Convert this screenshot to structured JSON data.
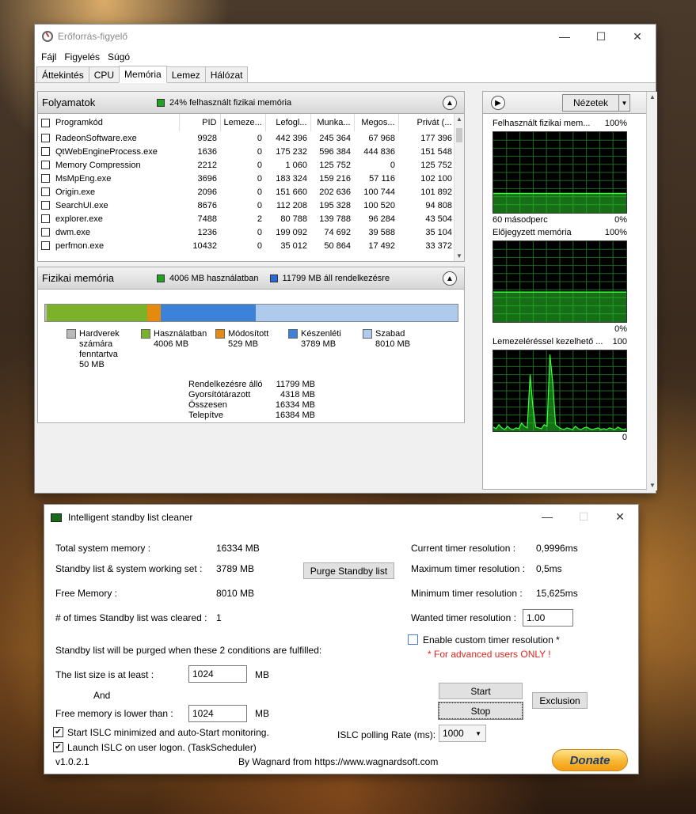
{
  "resmon": {
    "title": "Erőforrás-figyelő",
    "menu": [
      "Fájl",
      "Figyelés",
      "Súgó"
    ],
    "tabs": [
      "Áttekintés",
      "CPU",
      "Memória",
      "Lemez",
      "Hálózat"
    ],
    "active_tab": "Memória",
    "processes": {
      "title": "Folyamatok",
      "info": "24% felhasznált fizikai memória",
      "columns": [
        "Programkód",
        "PID",
        "Lemeze...",
        "Lefogl...",
        "Munka...",
        "Megos...",
        "Privát (..."
      ],
      "rows": [
        [
          "RadeonSoftware.exe",
          "9928",
          "0",
          "442 396",
          "245 364",
          "67 968",
          "177 396"
        ],
        [
          "QtWebEngineProcess.exe",
          "1636",
          "0",
          "175 232",
          "596 384",
          "444 836",
          "151 548"
        ],
        [
          "Memory Compression",
          "2212",
          "0",
          "1 060",
          "125 752",
          "0",
          "125 752"
        ],
        [
          "MsMpEng.exe",
          "3696",
          "0",
          "183 324",
          "159 216",
          "57 116",
          "102 100"
        ],
        [
          "Origin.exe",
          "2096",
          "0",
          "151 660",
          "202 636",
          "100 744",
          "101 892"
        ],
        [
          "SearchUI.exe",
          "8676",
          "0",
          "112 208",
          "195 328",
          "100 520",
          "94 808"
        ],
        [
          "explorer.exe",
          "7488",
          "2",
          "80 788",
          "139 788",
          "96 284",
          "43 504"
        ],
        [
          "dwm.exe",
          "1236",
          "0",
          "199 092",
          "74 692",
          "39 588",
          "35 104"
        ],
        [
          "perfmon.exe",
          "10432",
          "0",
          "35 012",
          "50 864",
          "17 492",
          "33 372"
        ]
      ]
    },
    "physical": {
      "title": "Fizikai memória",
      "info_used": "4006 MB használatban",
      "info_avail": "11799 MB áll rendelkezésre",
      "bar": [
        {
          "name": "hardware",
          "value": 50,
          "color": "#b9b9b9"
        },
        {
          "name": "in-use",
          "value": 4006,
          "color": "#7bb22a"
        },
        {
          "name": "modified",
          "value": 529,
          "color": "#e48a0e"
        },
        {
          "name": "standby",
          "value": 3789,
          "color": "#3c82d8"
        },
        {
          "name": "free",
          "value": 8010,
          "color": "#aecbee"
        }
      ],
      "legend": [
        {
          "label": "Hardverek",
          "sub": "számára",
          "sub2": "fenntartva",
          "value": "50 MB",
          "color": "#b9b9b9"
        },
        {
          "label": "Használatban",
          "value": "4006 MB",
          "color": "#7bb22a"
        },
        {
          "label": "Módosított",
          "value": "529 MB",
          "color": "#e48a0e"
        },
        {
          "label": "Készenléti",
          "value": "3789 MB",
          "color": "#3c82d8"
        },
        {
          "label": "Szabad",
          "value": "8010 MB",
          "color": "#aecbee"
        }
      ],
      "stats": [
        {
          "k": "Rendelkezésre álló",
          "v": "11799 MB"
        },
        {
          "k": "Gyorsítótárazott",
          "v": "4318 MB"
        },
        {
          "k": "Összesen",
          "v": "16334 MB"
        },
        {
          "k": "Telepítve",
          "v": "16384 MB"
        }
      ]
    },
    "right": {
      "views": "Nézetek",
      "graph1": {
        "title": "Felhasznált fizikai mem...",
        "max": "100%",
        "foot_left": "60 másodperc",
        "foot_right": "0%",
        "level": 0.24
      },
      "graph2": {
        "title": "Előjegyzett memória",
        "max": "100%",
        "foot_right": "0%",
        "level": 0.37
      },
      "graph3": {
        "title": "Lemezeléréssel kezelhető ...",
        "max": "100",
        "foot_right": "0",
        "values": [
          5,
          3,
          8,
          4,
          2,
          6,
          3,
          2,
          4,
          3,
          10,
          6,
          4,
          70,
          30,
          5,
          4,
          3,
          8,
          6,
          95,
          60,
          8,
          5,
          3,
          2,
          4,
          3,
          2,
          6,
          3,
          2,
          4,
          5,
          3,
          2,
          3,
          4,
          2,
          3,
          2,
          4,
          3,
          2,
          5,
          3,
          2,
          3
        ]
      }
    }
  },
  "islc": {
    "title": "Intelligent standby list cleaner",
    "total_label": "Total system memory :",
    "total_value": "16334 MB",
    "standby_label": "Standby list & system working set :",
    "standby_value": "3789 MB",
    "free_label": "Free Memory :",
    "free_value": "8010 MB",
    "cleared_label": "# of times Standby list was cleared :",
    "cleared_value": "1",
    "purge_button": "Purge Standby list",
    "cur_res_label": "Current timer resolution :",
    "cur_res_value": "0,9996ms",
    "max_res_label": "Maximum timer resolution :",
    "max_res_value": "0,5ms",
    "min_res_label": "Minimum timer resolution :",
    "min_res_value": "15,625ms",
    "wanted_label": "Wanted timer resolution :",
    "wanted_value": "1.00",
    "custom_label": "Enable custom timer resolution *",
    "advanced_note": "* For advanced users ONLY !",
    "conditions": "Standby list will be purged when these 2 conditions are fulfilled:",
    "list_size_label": "The list size is at least :",
    "list_size_value": "1024",
    "list_size_unit": "MB",
    "and": "And",
    "free_lower_label": "Free memory is lower than :",
    "free_lower_value": "1024",
    "free_lower_unit": "MB",
    "start_button": "Start",
    "stop_button": "Stop",
    "exclusion_button": "Exclusion",
    "chk_minimized": "Start ISLC minimized and auto-Start monitoring.",
    "chk_logon": "Launch ISLC on user logon. (TaskScheduler)",
    "polling_label": "ISLC polling Rate (ms):",
    "polling_value": "1000",
    "version": "v1.0.2.1",
    "credit": "By Wagnard from https://www.wagnardsoft.com",
    "donate": "Donate"
  }
}
